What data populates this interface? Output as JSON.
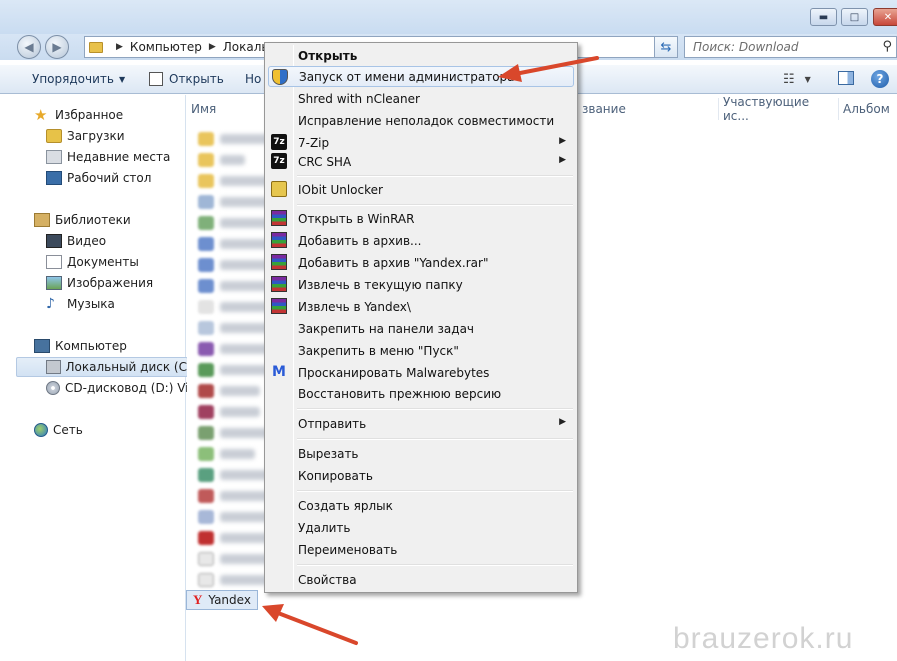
{
  "window": {
    "minimize": "▬",
    "maximize": "□",
    "close": "✕"
  },
  "address": {
    "crumbs": [
      "Компьютер",
      "Локальны"
    ],
    "search_placeholder": "Поиск: Download"
  },
  "toolbar": {
    "organize": "Упорядочить",
    "open": "Открыть",
    "new_partial": "Но"
  },
  "sidebar": {
    "favorites": "Избранное",
    "downloads": "Загрузки",
    "recent": "Недавние места",
    "desktop": "Рабочий стол",
    "libraries": "Библиотеки",
    "video": "Видео",
    "documents": "Документы",
    "images": "Изображения",
    "music": "Музыка",
    "computer": "Компьютер",
    "local_disk": "Локальный диск (C",
    "cd_drive": "CD-дисковод (D:) Vi",
    "network": "Сеть"
  },
  "columns": {
    "name": "Имя",
    "title_partial": "звание",
    "participants": "Участвующие ис...",
    "album": "Альбом"
  },
  "selected_file": "Yandex",
  "context_menu": {
    "open": "Открыть",
    "run_as_admin": "Запуск от имени администратора",
    "shred": "Shred with nCleaner",
    "compat": "Исправление неполадок совместимости",
    "zip": "7-Zip",
    "crc": "CRC SHA",
    "iobit": "IObit Unlocker",
    "open_winrar": "Открыть в WinRAR",
    "add_archive": "Добавить в архив...",
    "add_yandex_rar": "Добавить в архив \"Yandex.rar\"",
    "extract_here": "Извлечь в текущую папку",
    "extract_yandex": "Извлечь в Yandex\\",
    "pin_taskbar": "Закрепить на панели задач",
    "pin_start": "Закрепить в меню \"Пуск\"",
    "malwarebytes": "Просканировать Malwarebytes",
    "restore": "Восстановить прежнюю версию",
    "send_to": "Отправить",
    "cut": "Вырезать",
    "copy": "Копировать",
    "shortcut": "Создать ярлык",
    "delete": "Удалить",
    "rename": "Переименовать",
    "properties": "Свойства"
  },
  "icons": {
    "7zip_glyph": "7z",
    "malwarebytes_glyph": "M",
    "yandex_glyph": "Y"
  },
  "watermark": "brauzerok.ru",
  "colors": {
    "annotation_arrow": "#d9472b"
  }
}
